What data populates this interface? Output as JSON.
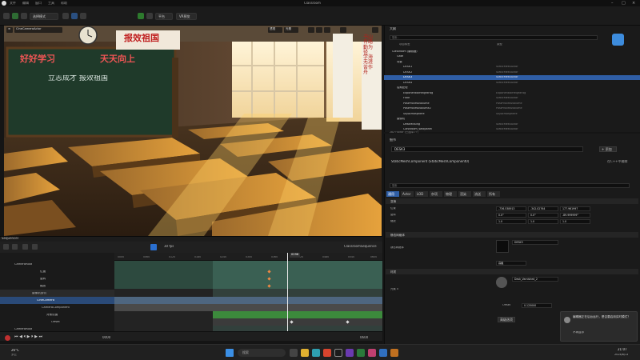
{
  "titlebar": {
    "menus": [
      "文件",
      "编辑",
      "窗口",
      "工具",
      "帮助"
    ],
    "project": "Classroom"
  },
  "toolbar": {
    "mode_button": "选择模式",
    "platform_button": "平台",
    "play_label": "VR预览"
  },
  "viewport": {
    "perspective": "透视",
    "lit": "光照",
    "camera": "CineCameraActor",
    "banner_left": "好好学习",
    "banner_right": "天天向上",
    "motto": "立志成才 报效祖国",
    "red_sign": "报效祖国",
    "right_poster": "书山有路勤为径 学海无涯苦作舟"
  },
  "sequencer": {
    "tab_title": "Sequencer",
    "fps": "30 fps",
    "sequence_name": "ClassroomSequence",
    "current_frame": "0296",
    "ruler_ticks": [
      "0000",
      "0060",
      "0120",
      "0180",
      "0240",
      "0300",
      "0360",
      "0420",
      "0480",
      "0540",
      "0600"
    ],
    "tracks": [
      {
        "label": "CameraRoot",
        "depth": 0
      },
      {
        "label": "位置",
        "depth": 2
      },
      {
        "label": "旋转",
        "depth": 2
      },
      {
        "label": "缩放",
        "depth": 2
      },
      {
        "label": "摄像机剪切",
        "depth": 0
      },
      {
        "label": "CineCamera",
        "depth": 1
      },
      {
        "label": "CameraComponent",
        "depth": 2
      },
      {
        "label": "对焦设置",
        "depth": 2
      },
      {
        "label": "Offset",
        "depth": 2
      },
      {
        "label": "CameraRoot",
        "depth": 0
      }
    ],
    "footer_start": "0000",
    "footer_end": "0600",
    "footer_left": "内容侧滑菜单",
    "footer_log": "输出日志",
    "footer_cmd": "Cmd"
  },
  "outliner": {
    "tab_title": "大纲",
    "search_placeholder": "搜索...",
    "col_item": "项目标签",
    "col_type": "类型",
    "rows": [
      {
        "label": "Classroom (编辑器)",
        "type": "World",
        "depth": 0,
        "selected": false
      },
      {
        "label": "Gate",
        "type": "",
        "depth": 1,
        "selected": false
      },
      {
        "label": "场景",
        "type": "",
        "depth": 1,
        "selected": false
      },
      {
        "label": "DESK1",
        "type": "StaticMeshActor",
        "depth": 2,
        "selected": false
      },
      {
        "label": "DESK2",
        "type": "StaticMeshActor",
        "depth": 2,
        "selected": false
      },
      {
        "label": "DESK3",
        "type": "StaticMeshActor",
        "depth": 2,
        "selected": true
      },
      {
        "label": "DESK4",
        "type": "StaticMeshActor",
        "depth": 2,
        "selected": false
      },
      {
        "label": "后期处理",
        "type": "",
        "depth": 1,
        "selected": false
      },
      {
        "label": "ExponentialHeightFog",
        "type": "ExponentialHeightFog",
        "depth": 2,
        "selected": false
      },
      {
        "label": "Floor",
        "type": "StaticMeshActor",
        "depth": 2,
        "selected": false
      },
      {
        "label": "PostProcessVolume",
        "type": "PostProcessVolume",
        "depth": 2,
        "selected": false
      },
      {
        "label": "PostProcessVolume2",
        "type": "PostProcessVolume",
        "depth": 2,
        "selected": false
      },
      {
        "label": "SkyAtmosphere",
        "type": "SkyAtmosphere",
        "depth": 2,
        "selected": false
      },
      {
        "label": "摄像机",
        "type": "",
        "depth": 1,
        "selected": false
      },
      {
        "label": "DeskMissing",
        "type": "StaticMeshActor",
        "depth": 2,
        "selected": false
      },
      {
        "label": "Classroom_Wallpanel",
        "type": "StaticMeshActor",
        "depth": 2,
        "selected": false
      }
    ],
    "status": "282个Actor (已选择1个)"
  },
  "details": {
    "tab_title": "细节",
    "actor_name": "DESK3",
    "add_button": "+ 添加",
    "component": "StaticMeshComponent (StaticMeshComponent0)",
    "edit_cpp": "在C++中编辑",
    "search_placeholder": "搜索",
    "tabs": [
      "通用",
      "Actor",
      "LOD",
      "杂项",
      "物理",
      "渲染",
      "流送",
      "所有"
    ],
    "section_transform": "变换",
    "transform": [
      {
        "label": "位置",
        "x": "-736.538913",
        "y": "-342.02764",
        "z": "177.961997"
      },
      {
        "label": "旋转",
        "x": "0.0°",
        "y": "0.0°",
        "z": "-89.999999°"
      },
      {
        "label": "缩放",
        "x": "1.0",
        "y": "1.0",
        "z": "1.0"
      }
    ],
    "section_mesh": "静态网格体",
    "mesh_label": "静态网格体",
    "mesh_value": "DESK3",
    "advanced": "高级",
    "section_materials": "材质",
    "material_label": "元素 0",
    "material_value": "Desk_Varnished_2",
    "offset_label": "Offset",
    "offset_value": "0.125000",
    "extra_button": "高级选项"
  },
  "notification": {
    "text": "编辑器正在后台运行，是否要启用实时模式？",
    "link": "不再显示"
  },
  "taskbar": {
    "weather": "26°C",
    "weather_sub": "多云",
    "search": "搜索",
    "time": "21:07",
    "date": "2024/6/13"
  }
}
